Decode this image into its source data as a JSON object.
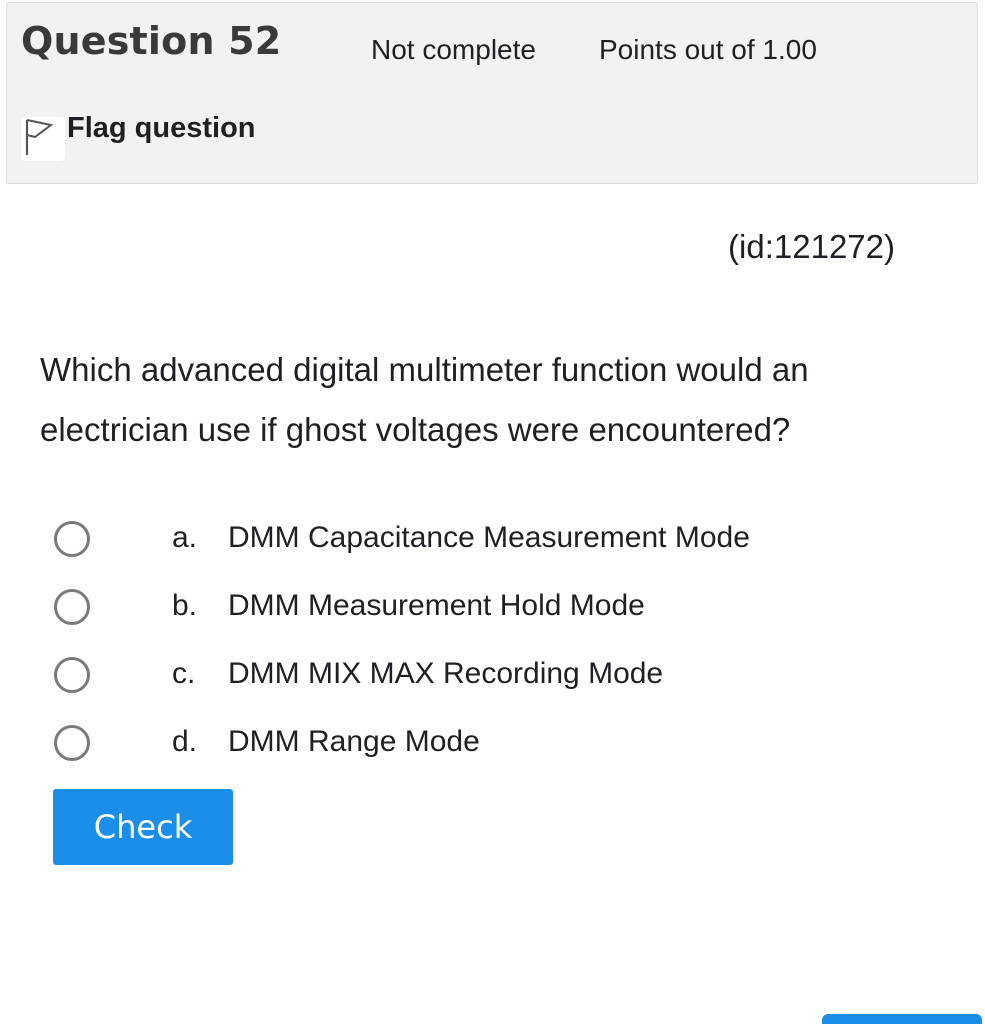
{
  "question_info": {
    "title": "Question 52",
    "state": "Not complete",
    "grade": "Points out of 1.00",
    "flag_label": "Flag question",
    "flag_icon": "flag-outline-icon"
  },
  "question": {
    "id_text": "(id:121272)",
    "text": "Which advanced digital multimeter function would an electrician use if ghost voltages were encountered?",
    "answers": [
      {
        "letter": "a.",
        "text": "DMM Capacitance Measurement Mode",
        "selected": false
      },
      {
        "letter": "b.",
        "text": "DMM Measurement Hold Mode",
        "selected": false
      },
      {
        "letter": "c.",
        "text": "DMM MIX MAX Recording Mode",
        "selected": false
      },
      {
        "letter": "d.",
        "text": "DMM Range Mode",
        "selected": false
      }
    ]
  },
  "actions": {
    "check_label": "Check"
  },
  "colors": {
    "accent": "#1a8ee8",
    "info_background": "#f2f2f2",
    "radio_border": "#7a7a7a"
  }
}
